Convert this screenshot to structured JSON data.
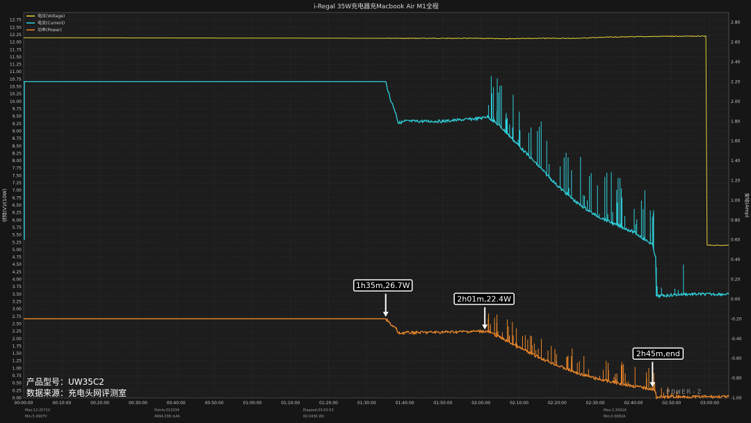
{
  "chart_data": {
    "type": "line",
    "title": "i-Regal 35W充电器充Macbook Air M1全程",
    "ylabel_left": "伏特(V)/(10W)",
    "ylabel_right": "安培(Amp)",
    "left_axis": {
      "min": 0,
      "max": 13.0,
      "ticks": [
        "0.00",
        "0.25",
        "0.50",
        "0.75",
        "1.00",
        "1.25",
        "1.50",
        "1.75",
        "2.00",
        "2.25",
        "2.50",
        "2.75",
        "3.00",
        "3.25",
        "3.50",
        "3.75",
        "4.00",
        "4.25",
        "4.50",
        "4.75",
        "5.00",
        "5.25",
        "5.50",
        "5.75",
        "6.00",
        "6.25",
        "6.50",
        "6.75",
        "7.00",
        "7.25",
        "7.50",
        "7.75",
        "8.00",
        "8.25",
        "8.50",
        "8.75",
        "9.00",
        "9.25",
        "9.50",
        "9.75",
        "10.00",
        "10.25",
        "10.50",
        "10.75",
        "11.00",
        "11.25",
        "11.50",
        "11.75",
        "12.00",
        "12.25",
        "12.50",
        "12.75"
      ]
    },
    "right_axis": {
      "min": -1.0,
      "max": 2.9,
      "ticks": [
        "-1.00",
        "-0.80",
        "-0.60",
        "-0.40",
        "-0.20",
        "0.00",
        "0.20",
        "0.40",
        "0.60",
        "0.80",
        "1.00",
        "1.20",
        "1.40",
        "1.60",
        "1.80",
        "2.00",
        "2.20",
        "2.40",
        "2.60",
        "2.80"
      ]
    },
    "x_axis": {
      "min_seconds": 0,
      "max_seconds": 11100,
      "ticks": [
        "00:00:00",
        "00:10:00",
        "00:20:00",
        "00:30:00",
        "00:40:00",
        "00:50:00",
        "01:00:00",
        "01:10:00",
        "01:20:00",
        "01:30:00",
        "01:40:00",
        "01:50:00",
        "02:00:00",
        "02:10:00",
        "02:20:00",
        "02:30:00",
        "02:40:00",
        "02:50:00",
        "03:00:00"
      ]
    },
    "legend": [
      "电压(Voltage)",
      "电流(Current)",
      "功率(Power)"
    ],
    "legend_position": "top-left",
    "grid": true,
    "series": [
      {
        "name": "电压(Voltage)",
        "axis": "left",
        "color": "#e6d43a",
        "points": [
          [
            0,
            12.15
          ],
          [
            3000,
            12.14
          ],
          [
            6000,
            12.13
          ],
          [
            7000,
            12.13
          ],
          [
            7600,
            12.12
          ],
          [
            8200,
            12.13
          ],
          [
            8700,
            12.13
          ],
          [
            9200,
            12.17
          ],
          [
            10200,
            12.2
          ],
          [
            10740,
            12.2
          ],
          [
            10760,
            5.15
          ],
          [
            11100,
            5.15
          ]
        ]
      },
      {
        "name": "电流(Current)",
        "axis": "right",
        "color": "#30d5e0",
        "left_end_value": 0.6,
        "points": [
          [
            0,
            2.2
          ],
          [
            5700,
            2.2
          ],
          [
            5760,
            2.05
          ],
          [
            5860,
            1.88
          ],
          [
            5900,
            1.78
          ],
          [
            6000,
            1.8
          ],
          [
            6600,
            1.8
          ],
          [
            7200,
            1.83
          ],
          [
            7300,
            1.85
          ],
          [
            7500,
            1.75
          ],
          [
            7800,
            1.55
          ],
          [
            8100,
            1.35
          ],
          [
            8400,
            1.15
          ],
          [
            8700,
            0.98
          ],
          [
            9000,
            0.85
          ],
          [
            9300,
            0.76
          ],
          [
            9600,
            0.68
          ],
          [
            9900,
            0.55
          ],
          [
            9950,
            0.42
          ],
          [
            9960,
            0.03
          ],
          [
            10400,
            0.05
          ],
          [
            11100,
            0.05
          ]
        ]
      },
      {
        "name": "功率(Power)",
        "axis": "left",
        "color": "#f08a2a",
        "points": [
          [
            0,
            2.67
          ],
          [
            5700,
            2.67
          ],
          [
            5760,
            2.52
          ],
          [
            5860,
            2.35
          ],
          [
            5900,
            2.18
          ],
          [
            6000,
            2.2
          ],
          [
            6600,
            2.22
          ],
          [
            7200,
            2.25
          ],
          [
            7300,
            2.24
          ],
          [
            7500,
            2.05
          ],
          [
            7800,
            1.7
          ],
          [
            8100,
            1.38
          ],
          [
            8400,
            1.1
          ],
          [
            8700,
            0.85
          ],
          [
            9000,
            0.66
          ],
          [
            9300,
            0.52
          ],
          [
            9600,
            0.4
          ],
          [
            9900,
            0.3
          ],
          [
            9950,
            0.18
          ],
          [
            9960,
            0.03
          ],
          [
            10400,
            0.04
          ],
          [
            11100,
            0.04
          ]
        ]
      }
    ],
    "annotations": [
      {
        "text": "1h35m,26.7W",
        "x_seconds": 5700,
        "y": 2.67
      },
      {
        "text": "2h01m,22.4W",
        "x_seconds": 7260,
        "y": 2.24
      },
      {
        "text": "2h45m,end",
        "x_seconds": 9900,
        "y": 0.3
      }
    ]
  },
  "stats": {
    "max_voltage": "Max:12.2571V",
    "min_voltage": "Min:5.0907V",
    "points": "Points:011034",
    "capacity": "4994.038 mAh",
    "elapsed": "Elapsed:03:03:53",
    "energy": "60.0436 Wh",
    "max_current": "Max:2.3091A",
    "min_current": "Min:0.0082A"
  },
  "info": {
    "model": "产品型号：UW35C2",
    "source": "数据来源：充电头网评测室"
  },
  "watermark": "POWER-Z"
}
